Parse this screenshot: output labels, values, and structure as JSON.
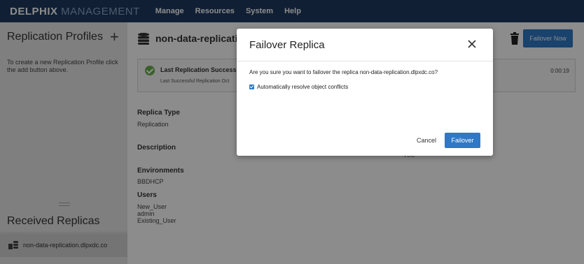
{
  "app": {
    "brand_bold": "DELPHIX",
    "brand_light": " MANAGEMENT",
    "nav": [
      "Manage",
      "Resources",
      "System",
      "Help"
    ]
  },
  "sidebar": {
    "title": "Replication Profiles",
    "add_symbol": "+",
    "description": "To create a new Replication Profile click the add button above.",
    "received_title": "Received Replicas",
    "replica_item": "non-data-replication.dlpxdc.co"
  },
  "main": {
    "title": "non-data-replication.c",
    "failover_now_label": "Failover Now",
    "status": {
      "title": "Last Replication Successfu",
      "subtitle": "Last Successful Replication Oct",
      "time": "0:00:19"
    },
    "fields": {
      "replica_type_label": "Replica Type",
      "replica_type_value": "Replication",
      "description_label": "Description",
      "environments_label": "Environments",
      "environments_value": "BBDHCP",
      "users_label": "Users",
      "users": [
        "New_User",
        "admin",
        "Existing_User"
      ],
      "vdb_partial": "VDB"
    }
  },
  "modal": {
    "title": "Failover Replica",
    "message": "Are you sure you want to failover the replica non-data-replication.dlpxdc.co?",
    "checkbox_label": "Automatically resolve object conflicts",
    "checkbox_checked": true,
    "cancel_label": "Cancel",
    "failover_label": "Failover"
  },
  "colors": {
    "topbar": "#1e3a5f",
    "primary": "#2e78c7",
    "success": "#6ab04c"
  }
}
